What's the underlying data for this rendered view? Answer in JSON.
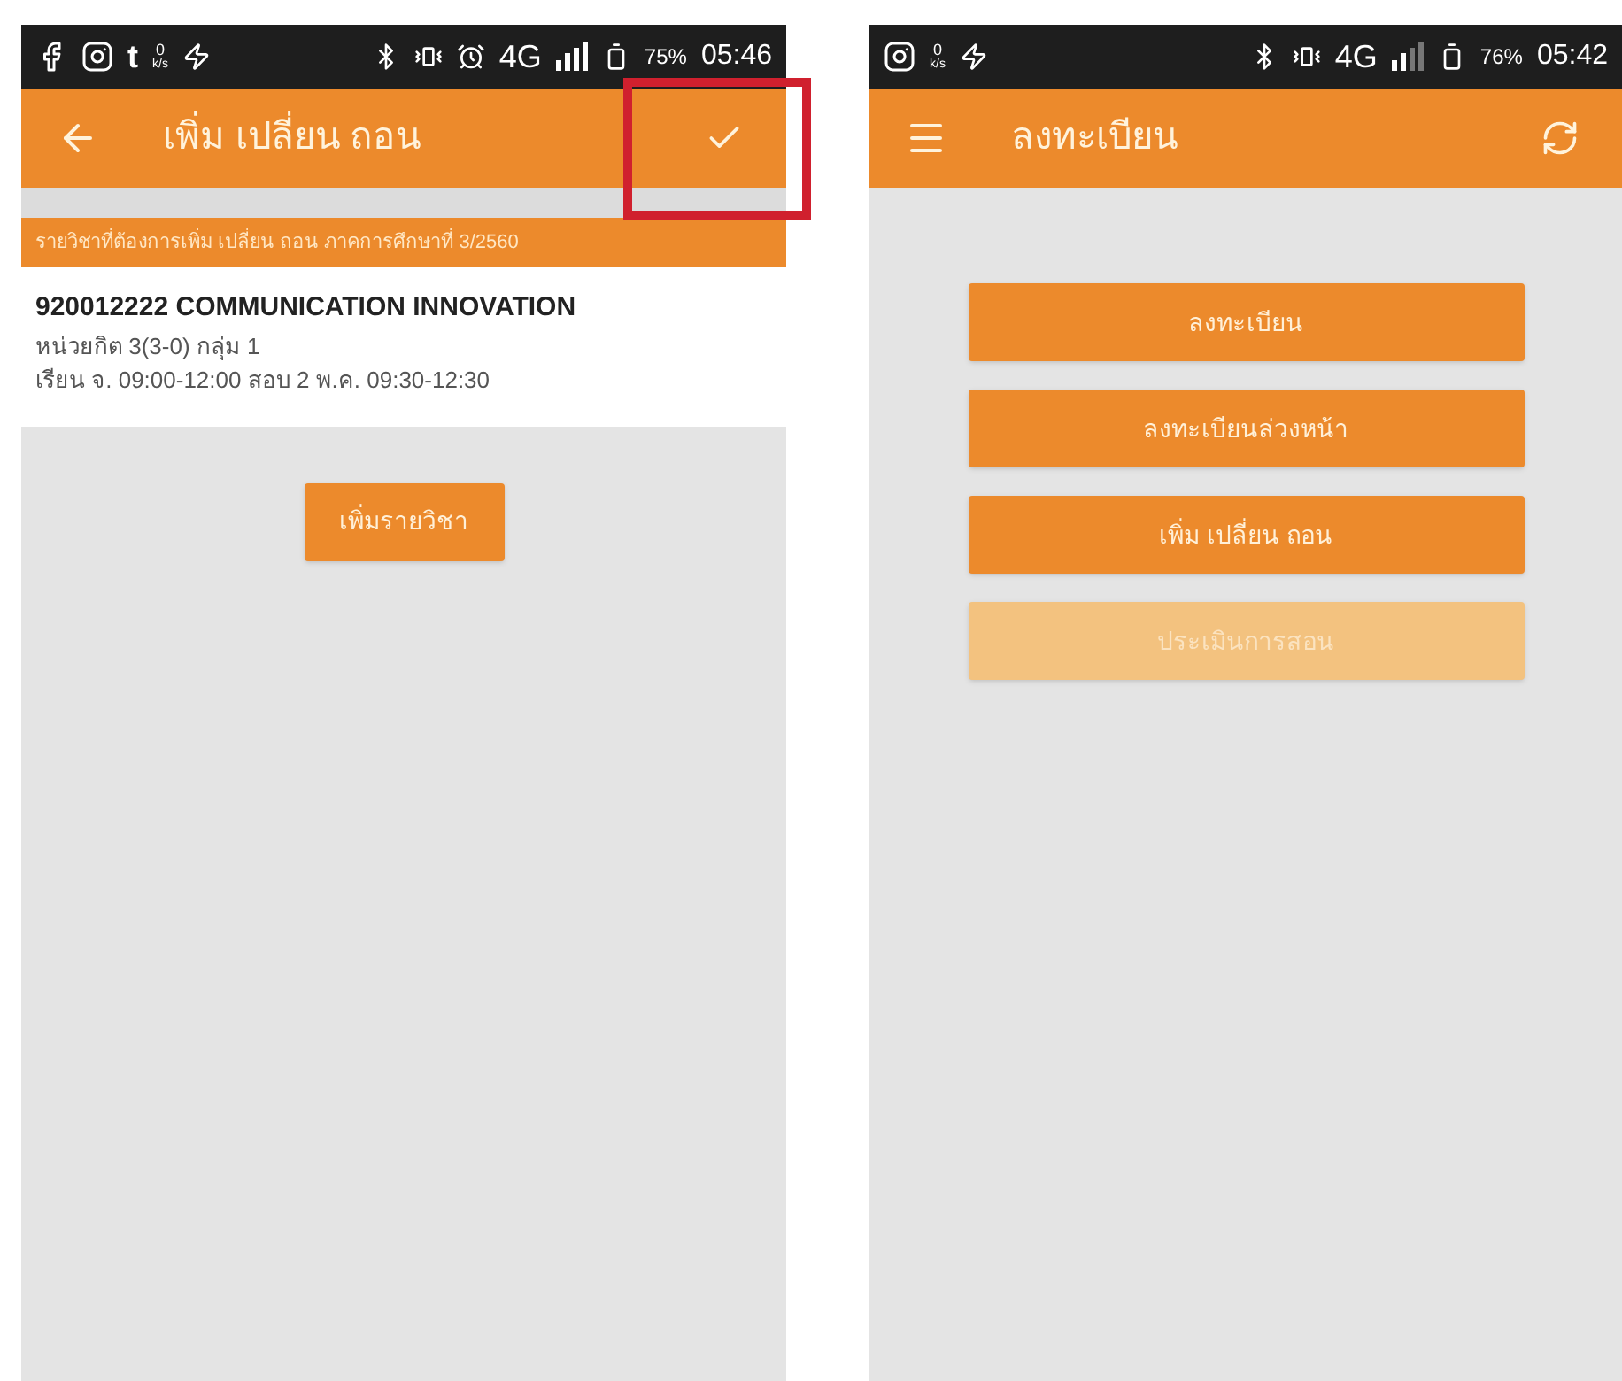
{
  "screens": [
    {
      "status_bar": {
        "letter": "t",
        "speed": "0",
        "speed_unit": "k/s",
        "network": "4G",
        "battery": "75%",
        "time": "05:46"
      },
      "kind": "form",
      "app_bar": {
        "title": "เพิ่ม เปลี่ยน ถอน",
        "highlighted": true
      },
      "subtitle": "รายวิชาที่ต้องการเพิ่ม เปลี่ยน ถอน ภาคการศึกษาที่ 3/2560",
      "course": {
        "title": "920012222 COMMUNICATION INNOVATION",
        "lines": [
          "หน่วยกิต 3(3-0) กลุ่ม 1",
          "เรียน จ. 09:00-12:00 สอบ 2 พ.ค. 09:30-12:30"
        ]
      },
      "buttons": [
        {
          "label": "เพิ่มรายวิชา",
          "disabled": false
        }
      ]
    },
    {
      "status_bar": {
        "speed": "0",
        "speed_unit": "k/s",
        "network": "4G",
        "battery": "76%",
        "time": "05:42"
      },
      "kind": "menu",
      "app_bar": {
        "title": "ลงทะเบียน"
      },
      "buttons": [
        {
          "label": "ลงทะเบียน",
          "disabled": false
        },
        {
          "label": "ลงทะเบียนล่วงหน้า",
          "disabled": false
        },
        {
          "label": "เพิ่ม เปลี่ยน ถอน",
          "disabled": false
        },
        {
          "label": "ประเมินการสอน",
          "disabled": true
        }
      ]
    }
  ]
}
